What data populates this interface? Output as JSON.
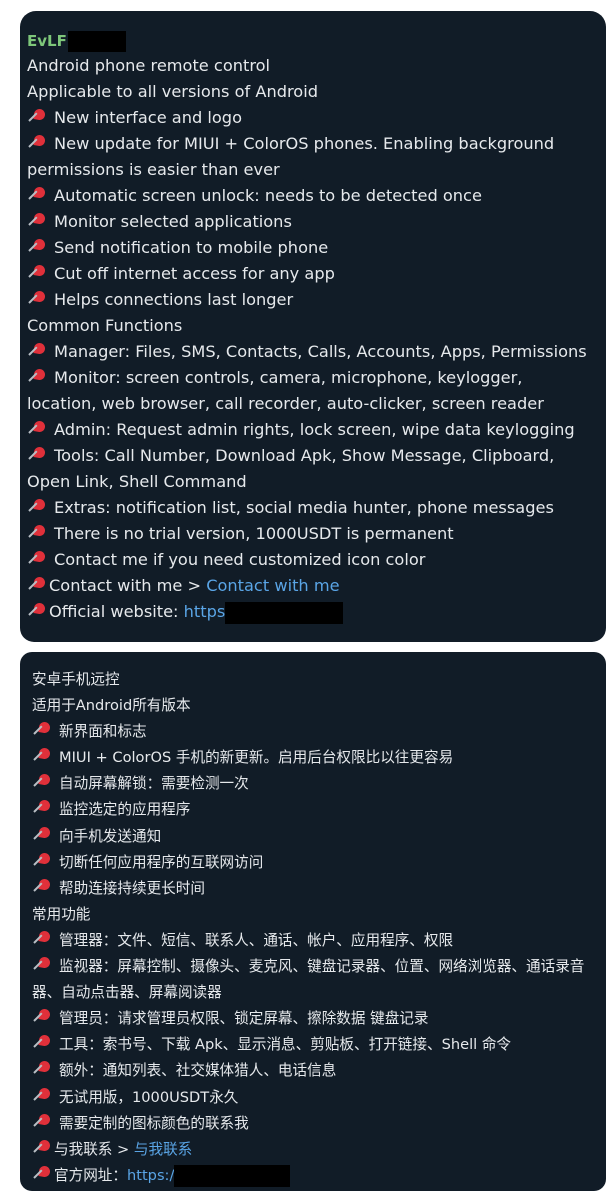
{
  "english_panel": {
    "sender": "EvLF",
    "lines": [
      {
        "pin": false,
        "text": "Android phone remote control"
      },
      {
        "pin": false,
        "text": "Applicable to all versions of Android"
      },
      {
        "pin": true,
        "text": "New interface and logo"
      },
      {
        "pin": true,
        "text": "New update for MIUI + ColorOS phones. Enabling background permissions is easier than ever",
        "wrap": true
      },
      {
        "pin": true,
        "text": "Automatic screen unlock: needs to be detected once"
      },
      {
        "pin": true,
        "text": "Monitor selected applications"
      },
      {
        "pin": true,
        "text": "Send notification to mobile phone"
      },
      {
        "pin": true,
        "text": "Cut off internet access for any app"
      },
      {
        "pin": true,
        "text": "Helps connections last longer"
      },
      {
        "pin": false,
        "text": "Common Functions"
      },
      {
        "pin": true,
        "text": "Manager: Files, SMS, Contacts, Calls, Accounts, Apps, Permissions"
      },
      {
        "pin": true,
        "text": "Monitor: screen controls, camera, microphone, keylogger, location, web browser, call recorder, auto-clicker, screen reader",
        "wrap": true
      },
      {
        "pin": true,
        "text": "Admin: Request admin rights, lock screen, wipe data  keylogging"
      },
      {
        "pin": true,
        "text": "Tools: Call Number, Download Apk, Show Message, Clipboard, Open Link, Shell Command",
        "wrap": true
      },
      {
        "pin": true,
        "text": "Extras: notification list, social media hunter, phone messages"
      },
      {
        "pin": true,
        "text": "There is no trial version, 1000USDT is permanent"
      },
      {
        "pin": true,
        "text": "Contact me if you need customized icon color"
      }
    ],
    "contact_prefix": "Contact with me > ",
    "contact_link": "Contact with me",
    "website_label": "Official website: ",
    "website_link": "https"
  },
  "chinese_panel": {
    "lines": [
      {
        "pin": false,
        "text": "安卓手机远控"
      },
      {
        "pin": false,
        "text": "适用于Android所有版本"
      },
      {
        "pin": true,
        "text": "新界面和标志"
      },
      {
        "pin": true,
        "text": "MIUI + ColorOS 手机的新更新。启用后台权限比以往更容易"
      },
      {
        "pin": true,
        "text": "自动屏幕解锁：需要检测一次"
      },
      {
        "pin": true,
        "text": "监控选定的应用程序"
      },
      {
        "pin": true,
        "text": "向手机发送通知"
      },
      {
        "pin": true,
        "text": "切断任何应用程序的互联网访问"
      },
      {
        "pin": true,
        "text": "帮助连接持续更长时间"
      },
      {
        "pin": false,
        "text": "常用功能"
      },
      {
        "pin": true,
        "text": "管理器：文件、短信、联系人、通话、帐户、应用程序、权限"
      },
      {
        "pin": true,
        "text": "监视器：屏幕控制、摄像头、麦克风、键盘记录器、位置、网络浏览器、通话录音器、自动点击器、屏幕阅读器",
        "wrap": true
      },
      {
        "pin": true,
        "text": "管理员：请求管理员权限、锁定屏幕、擦除数据 键盘记录"
      },
      {
        "pin": true,
        "text": "工具：索书号、下载 Apk、显示消息、剪贴板、打开链接、Shell 命令"
      },
      {
        "pin": true,
        "text": "额外：通知列表、社交媒体猎人、电话信息"
      },
      {
        "pin": true,
        "text": "无试用版，1000USDT永久"
      },
      {
        "pin": true,
        "text": "需要定制的图标颜色的联系我"
      }
    ],
    "contact_prefix": "与我联系 > ",
    "contact_link": "与我联系",
    "website_label": "官方网址：",
    "website_link": "https:/"
  },
  "colors": {
    "panel_bg": "#111c27",
    "text": "#e6e9ec",
    "sender": "#7ec77a",
    "link": "#5aa5e6",
    "pin_icon": "#e0303a"
  }
}
